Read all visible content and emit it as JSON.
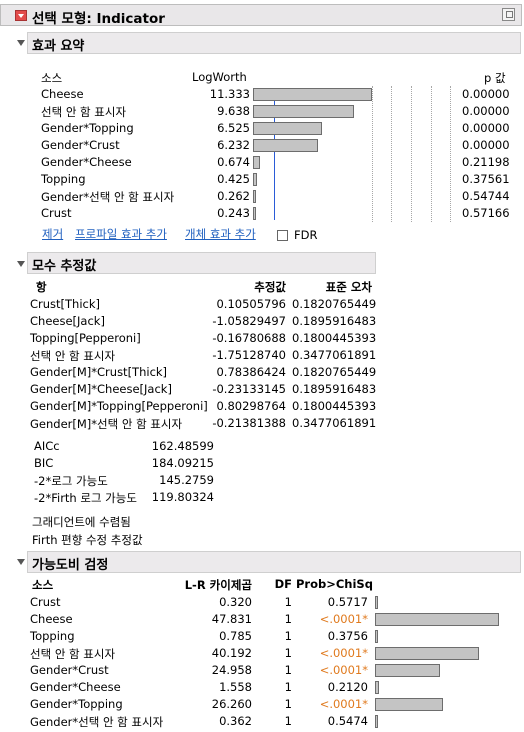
{
  "window": {
    "title": "선택 모형: Indicator"
  },
  "effect_summary": {
    "title": "효과 요약",
    "col_source": "소스",
    "col_logworth": "LogWorth",
    "col_p": "p 값",
    "rows": [
      {
        "source": "Cheese",
        "logworth": "11.333",
        "p": "0.00000"
      },
      {
        "source": "선택 안 함 표시자",
        "logworth": "9.638",
        "p": "0.00000"
      },
      {
        "source": "Gender*Topping",
        "logworth": "6.525",
        "p": "0.00000"
      },
      {
        "source": "Gender*Crust",
        "logworth": "6.232",
        "p": "0.00000"
      },
      {
        "source": "Gender*Cheese",
        "logworth": "0.674",
        "p": "0.21198"
      },
      {
        "source": "Topping",
        "logworth": "0.425",
        "p": "0.37561"
      },
      {
        "source": "Gender*선택 안 함 표시자",
        "logworth": "0.262",
        "p": "0.54744"
      },
      {
        "source": "Crust",
        "logworth": "0.243",
        "p": "0.57166"
      }
    ],
    "actions": {
      "remove": "제거",
      "add_profile": "프로파일 효과 추가",
      "add_subject": "개체 효과 추가",
      "fdr": "FDR"
    }
  },
  "param_estimates": {
    "title": "모수 추정값",
    "col_term": "항",
    "col_estimate": "추정값",
    "col_se": "표준 오차",
    "rows": [
      {
        "term": "Crust[Thick]",
        "estimate": "0.10505796",
        "se": "0.1820765449"
      },
      {
        "term": "Cheese[Jack]",
        "estimate": "-1.05829497",
        "se": "0.1895916483"
      },
      {
        "term": "Topping[Pepperoni]",
        "estimate": "-0.16780688",
        "se": "0.1800445393"
      },
      {
        "term": "선택 안 함 표시자",
        "estimate": "-1.75128740",
        "se": "0.3477061891"
      },
      {
        "term": "Gender[M]*Crust[Thick]",
        "estimate": "0.78386424",
        "se": "0.1820765449"
      },
      {
        "term": "Gender[M]*Cheese[Jack]",
        "estimate": "-0.23133145",
        "se": "0.1895916483"
      },
      {
        "term": "Gender[M]*Topping[Pepperoni]",
        "estimate": "0.80298764",
        "se": "0.1800445393"
      },
      {
        "term": "Gender[M]*선택 안 함 표시자",
        "estimate": "-0.21381388",
        "se": "0.3477061891"
      }
    ],
    "fit_stats": [
      {
        "label": "AICc",
        "value": "162.48599"
      },
      {
        "label": "BIC",
        "value": "184.09215"
      },
      {
        "label": "-2*로그 가능도",
        "value": "145.2759"
      },
      {
        "label": "-2*Firth 로그 가능도",
        "value": "119.80324"
      }
    ],
    "notes": [
      "그래디언트에 수렴됨",
      "Firth 편향 수정 추정값"
    ]
  },
  "lr_test": {
    "title": "가능도비 검정",
    "col_source": "소스",
    "col_chisq": "L-R 카이제곱",
    "col_df": "DF",
    "col_prob": "Prob>ChiSq",
    "rows": [
      {
        "source": "Crust",
        "chisq": "0.320",
        "df": "1",
        "prob": "0.5717",
        "sig": false
      },
      {
        "source": "Cheese",
        "chisq": "47.831",
        "df": "1",
        "prob": "<.0001*",
        "sig": true
      },
      {
        "source": "Topping",
        "chisq": "0.785",
        "df": "1",
        "prob": "0.3756",
        "sig": false
      },
      {
        "source": "선택 안 함 표시자",
        "chisq": "40.192",
        "df": "1",
        "prob": "<.0001*",
        "sig": true
      },
      {
        "source": "Gender*Crust",
        "chisq": "24.958",
        "df": "1",
        "prob": "<.0001*",
        "sig": true
      },
      {
        "source": "Gender*Cheese",
        "chisq": "1.558",
        "df": "1",
        "prob": "0.2120",
        "sig": false
      },
      {
        "source": "Gender*Topping",
        "chisq": "26.260",
        "df": "1",
        "prob": "<.0001*",
        "sig": true
      },
      {
        "source": "Gender*선택 안 함 표시자",
        "chisq": "0.362",
        "df": "1",
        "prob": "0.5474",
        "sig": false
      }
    ]
  }
}
